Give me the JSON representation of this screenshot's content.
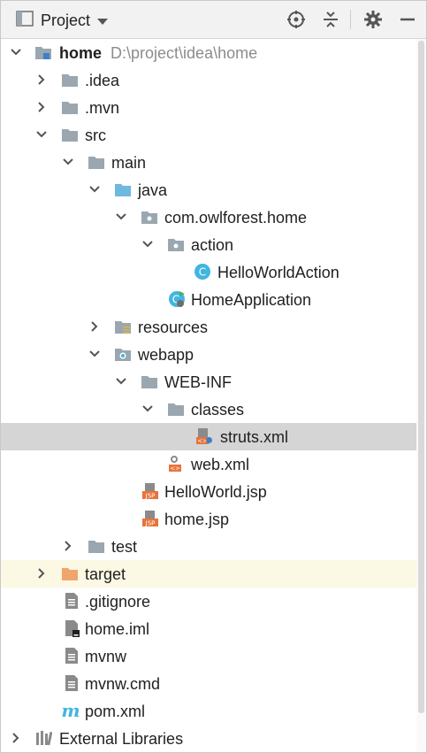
{
  "header": {
    "title": "Project",
    "icons": [
      "project-view-icon",
      "locate-icon",
      "collapse-all-icon",
      "settings-gear-icon",
      "minimize-icon"
    ]
  },
  "tree": {
    "home": {
      "name": "home",
      "path": "D:\\project\\idea\\home"
    },
    "idea": ".idea",
    "mvn": ".mvn",
    "src": "src",
    "main": "main",
    "java": "java",
    "package": "com.owlforest.home",
    "action": "action",
    "hello_action": "HelloWorldAction",
    "home_app": "HomeApplication",
    "resources": "resources",
    "webapp": "webapp",
    "webinf": "WEB-INF",
    "classes": "classes",
    "struts": "struts.xml",
    "webxml": "web.xml",
    "hello_jsp": "HelloWorld.jsp",
    "home_jsp": "home.jsp",
    "test": "test",
    "target": "target",
    "gitignore": ".gitignore",
    "home_iml": "home.iml",
    "mvnw": "mvnw",
    "mvnw_cmd": "mvnw.cmd",
    "pom": "pom.xml",
    "ext_libs": "External Libraries"
  },
  "colors": {
    "selected_row": "#d5d5d5",
    "excluded_row": "#fbf8e3",
    "folder_gray": "#9aa7b0",
    "source_folder": "#6fb8e0",
    "excluded_folder": "#f0a56b",
    "class_icon": "#40b6e0",
    "jsp_icon": "#e8733a"
  }
}
